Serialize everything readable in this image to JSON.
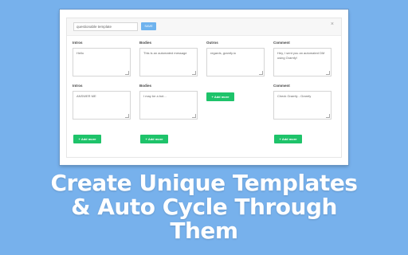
{
  "editor": {
    "name_value": "questionable template",
    "save_label": "SAVE",
    "close_glyph": "×",
    "rows": [
      {
        "columns": [
          {
            "label": "Intros",
            "text": "Hello"
          },
          {
            "label": "Bodies",
            "text": "This is an automated message"
          },
          {
            "label": "Outros",
            "text": "regards, gramfy.io"
          },
          {
            "label": "Comment",
            "text": "Hey, I sent you an automated DM using Gramfy!"
          }
        ]
      },
      {
        "columns": [
          {
            "label": "Intros",
            "text": "ANSWER ME"
          },
          {
            "label": "Bodies",
            "text": "I may be a bot..."
          },
          {
            "label": "",
            "text": ""
          },
          {
            "label": "Comment",
            "text": "Check Gramfy - Gramfy"
          }
        ]
      }
    ],
    "add_more_label": "+ Add more"
  },
  "caption": {
    "line1": "Create Unique Templates",
    "line2": "& Auto Cycle Through",
    "line3": "Them"
  },
  "colors": {
    "background": "#77b1ec",
    "save": "#6fb3ee",
    "add_more": "#1ec36a"
  }
}
